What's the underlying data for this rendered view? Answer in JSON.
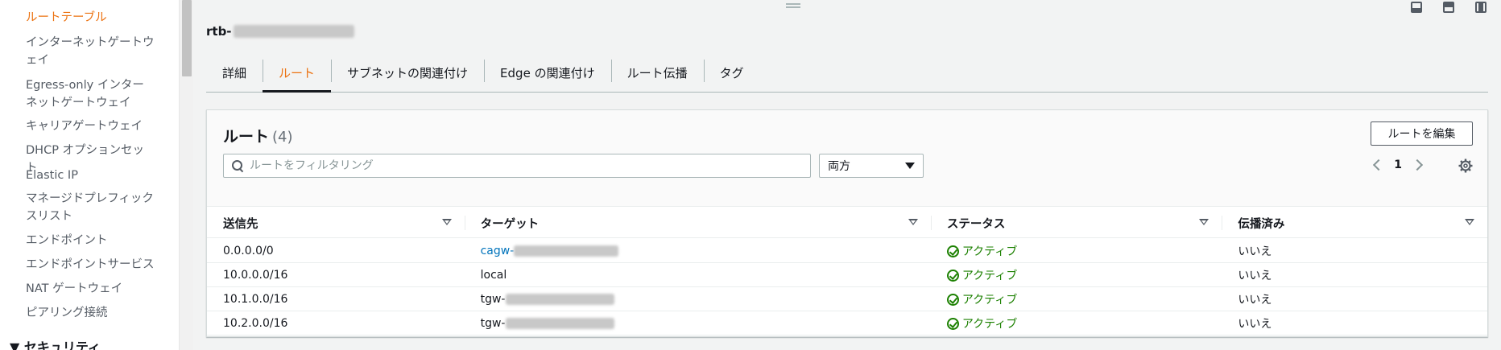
{
  "sidebar": {
    "items": [
      {
        "label": "ルートテーブル",
        "active": true
      },
      {
        "label": "インターネットゲートウェイ"
      },
      {
        "label": "Egress-only インターネットゲートウェイ"
      },
      {
        "label": "キャリアゲートウェイ"
      },
      {
        "label": "DHCP オプションセット"
      },
      {
        "label": "Elastic IP"
      },
      {
        "label": "マネージドプレフィックスリスト"
      },
      {
        "label": "エンドポイント"
      },
      {
        "label": "エンドポイントサービス"
      },
      {
        "label": "NAT ゲートウェイ"
      },
      {
        "label": "ピアリング接続"
      }
    ],
    "section": "▼ セキュリティ"
  },
  "detail": {
    "title_prefix": "rtb-"
  },
  "tabs": [
    {
      "label": "詳細"
    },
    {
      "label": "ルート",
      "active": true
    },
    {
      "label": "サブネットの関連付け"
    },
    {
      "label": "Edge の関連付け"
    },
    {
      "label": "ルート伝播"
    },
    {
      "label": "タグ"
    }
  ],
  "panel": {
    "title": "ルート",
    "count": "(4)",
    "edit_button": "ルートを編集",
    "search_placeholder": "ルートをフィルタリング",
    "select_value": "両方",
    "page": "1"
  },
  "table": {
    "headers": [
      "送信先",
      "ターゲット",
      "ステータス",
      "伝播済み"
    ],
    "rows": [
      {
        "destination": "0.0.0.0/0",
        "target": "cagw-",
        "target_link": true,
        "status": "アクティブ",
        "propagated": "いいえ"
      },
      {
        "destination": "10.0.0.0/16",
        "target": "local",
        "target_link": false,
        "status": "アクティブ",
        "propagated": "いいえ"
      },
      {
        "destination": "10.1.0.0/16",
        "target": "tgw-",
        "target_link": false,
        "status": "アクティブ",
        "propagated": "いいえ"
      },
      {
        "destination": "10.2.0.0/16",
        "target": "tgw-",
        "target_link": false,
        "status": "アクティブ",
        "propagated": "いいえ"
      }
    ]
  },
  "colors": {
    "accent": "#ec7211",
    "link": "#0073bb",
    "success": "#1d8102"
  }
}
